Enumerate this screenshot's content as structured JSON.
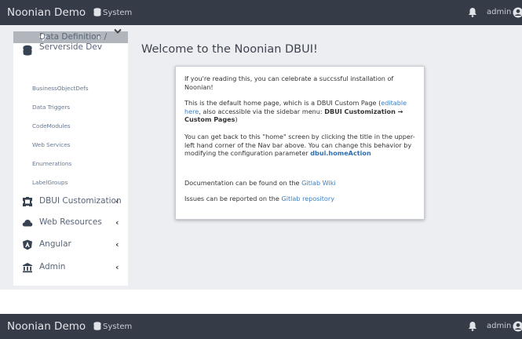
{
  "navbar": {
    "brand": "Noonian Demo",
    "system_label": "System",
    "user": "admin"
  },
  "sidebar": {
    "collapse_label": "«",
    "data_definition": {
      "label_line1": "Data Definition /",
      "label_line2": "Serverside Dev",
      "expanded": true,
      "items": [
        {
          "label": "BusinessObjectDefs"
        },
        {
          "label": "Data Triggers"
        },
        {
          "label": "CodeModules"
        },
        {
          "label": "Web Services"
        },
        {
          "label": "Enumerations"
        },
        {
          "label": "LabelGroups"
        }
      ]
    },
    "sections": [
      {
        "label": "DBUI Customization",
        "icon": "puzzle-icon"
      },
      {
        "label": "Web Resources",
        "icon": "cloud-icon"
      },
      {
        "label": "Angular",
        "icon": "angular-icon"
      },
      {
        "label": "Admin",
        "icon": "building-icon"
      }
    ]
  },
  "main": {
    "title": "Welcome to the Noonian DBUI!",
    "p1": "If you're reading this, you can celebrate a succssful installation of Noonian!",
    "p2_before": "This is the default home page, which is a DBUI Custom Page (",
    "p2_link": "editable here",
    "p2_middle": ", also accessible via the sidebar menu: ",
    "p2_menu": "DBUI Customization → Custom Pages",
    "p2_after": ")",
    "p3": "You can get back to this \"home\" screen by clicking the title in the upper-left hand corner of the Nav bar above. You can change this behavior by modifying the configuration parameter",
    "p3_param": "dbui.homeAction",
    "p4_before": "Documentation can be found on the ",
    "p4_link": "Gitlab Wiki",
    "p5_before": "Issues can be reported on the ",
    "p5_link": "Gitlab repository"
  },
  "colors": {
    "navbar": "#363b48",
    "background": "#eceef1",
    "sidebar_header": "#b1b5bc",
    "link": "#3d80c4"
  }
}
